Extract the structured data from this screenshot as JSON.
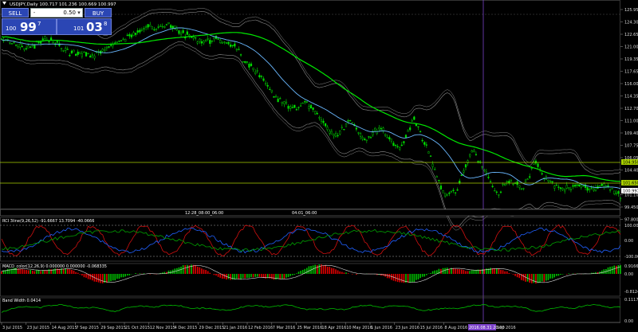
{
  "window": {
    "symbol_line": "USDJPY,Daily  100.717 101.236 100.669 100.997"
  },
  "trade_panel": {
    "sell_label": "SELL",
    "buy_label": "BUY",
    "lot_value": "0.50",
    "bid_small": "100",
    "bid_big": "99",
    "bid_sup": "7",
    "ask_small": "101",
    "ask_big": "03",
    "ask_sup": "8"
  },
  "price_axis": {
    "ticks": [
      "125.950",
      "124.300",
      "122.650",
      "121.000",
      "119.350",
      "117.650",
      "116.000",
      "114.350",
      "112.700",
      "111.000",
      "109.400",
      "107.750",
      "106.050",
      "104.400",
      "102.750",
      "101.100",
      "99.450",
      "97.800"
    ],
    "current_price": "100.997",
    "marker_upper": "104.950",
    "marker_lower": "101.650"
  },
  "rci_pane": {
    "title": "RCI 3line(9,26,52) -91.6667 13.7094 -40.0666",
    "ticks": [
      "100.00",
      "0.00",
      "-100.00"
    ]
  },
  "macd_pane": {
    "title": "MACD_color(12,26,9) 0.000000 0.000000 -0.068335",
    "ticks": [
      "0.916652",
      "0.00",
      "-0.812425"
    ]
  },
  "band_pane": {
    "title": "Band Width 0.0414",
    "ticks": [
      "0.111765",
      "0.00"
    ]
  },
  "time_axis": {
    "labels": [
      "3 Jul 2015",
      "23 Jul 2015",
      "14 Aug 2015",
      "7 Sep 2015",
      "29 Sep 2015",
      "21 Oct 2015",
      "12 Nov 2015",
      "4 Dec 2015",
      "29 Dec 2015",
      "21 Jan 2016",
      "12 Feb 2016",
      "7 Mar 2016",
      "25 Mar 2016",
      "18 Apr 2016",
      "10 May 2016",
      "1 Jun 2016",
      "23 Jun 2016",
      "15 Jul 2016",
      "8 Aug 2016"
    ],
    "highlight_label": "2016.08.31 20:00",
    "tail_label": "Sep 2016"
  },
  "annotations": {
    "mid_left": "12:28_08:00_06:00",
    "mid_right": "04:01_06:00"
  },
  "colors": {
    "background": "#000000",
    "candle": "#00e000",
    "ma_long": "#00e800",
    "ma_mid": "#6ab8ff",
    "bands": "#8a8a8a",
    "hline": "#a8d000",
    "vline": "#7a40c8",
    "rci_red": "#d01010",
    "rci_blue": "#2060ff",
    "rci_green": "#00a000",
    "macd_up": "#00c000",
    "macd_down": "#e00000",
    "band_width": "#00c000",
    "panel_blue": "#2b46b4"
  }
}
